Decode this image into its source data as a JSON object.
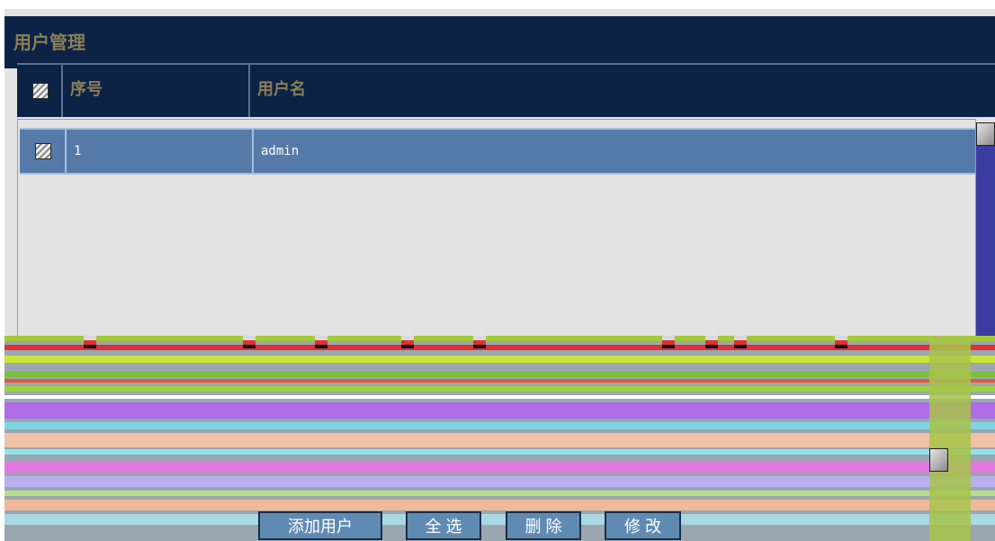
{
  "panel": {
    "title": "用户管理"
  },
  "table": {
    "headers": [
      "序号",
      "用户名"
    ],
    "rows": [
      {
        "seq": "1",
        "username": "admin"
      }
    ]
  },
  "actions": {
    "add_user": "添加用户",
    "select_all": "全 选",
    "delete": "删 除",
    "edit": "修 改"
  },
  "colors": {
    "header_bg": "#0d2346",
    "header_text": "#8a7e54",
    "selected_row": "#557aa8",
    "button_bg": "#5f8bb3"
  },
  "icons": [
    "checkbox-icon",
    "scroll-up-icon",
    "scroll-down-icon"
  ]
}
